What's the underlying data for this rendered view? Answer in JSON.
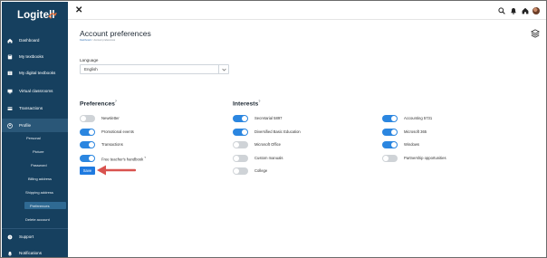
{
  "app": {
    "logo_text": "Logitell",
    "brand_color": "#16405f",
    "accent_color": "#2b86e0"
  },
  "sidebar": {
    "items": [
      {
        "label": "Dashboard",
        "icon": "home-icon"
      },
      {
        "label": "My textbooks",
        "icon": "book-icon"
      },
      {
        "label": "My digital textbooks",
        "icon": "tablet-book-icon"
      },
      {
        "label": "Virtual classrooms",
        "icon": "classroom-icon"
      },
      {
        "label": "Transactions",
        "icon": "transactions-icon"
      },
      {
        "label": "Profile",
        "icon": "profile-icon"
      }
    ],
    "profile_subitems": [
      {
        "label": "Personal"
      },
      {
        "label": "Picture"
      },
      {
        "label": "Password"
      },
      {
        "label": "Billing address"
      },
      {
        "label": "Shipping address"
      },
      {
        "label": "Preferences"
      },
      {
        "label": "Delete account"
      }
    ],
    "bottom_items": [
      {
        "label": "Support",
        "icon": "support-icon"
      },
      {
        "label": "Notifications",
        "icon": "bell-icon"
      }
    ]
  },
  "topbar": {
    "close_icon": "close-icon",
    "icons": [
      "search-icon",
      "bell-icon",
      "home-icon",
      "avatar"
    ]
  },
  "page": {
    "title": "Account preferences",
    "breadcrumb": [
      "Dashboard",
      "Account preferences"
    ]
  },
  "language": {
    "label": "Language",
    "value": "English"
  },
  "preferences": {
    "title": "Preferences",
    "superscript": "?",
    "items": [
      {
        "label": "Newsletter",
        "on": false
      },
      {
        "label": "Promotional events",
        "on": true
      },
      {
        "label": "Transactions",
        "on": true
      },
      {
        "label": "Free teacher's handbook",
        "superscript": "?",
        "on": true
      }
    ],
    "save_label": "Save"
  },
  "interests": {
    "title": "Interests",
    "superscript": "?",
    "column1": [
      {
        "label": "Secretarial 5897",
        "on": true
      },
      {
        "label": "Diversified Basic Education",
        "on": true
      },
      {
        "label": "Microsoft Office",
        "on": false
      },
      {
        "label": "Custom manuals",
        "on": false
      },
      {
        "label": "College",
        "on": false
      }
    ],
    "column2": [
      {
        "label": "Accounting 5731",
        "on": true
      },
      {
        "label": "Microsoft 365",
        "on": true
      },
      {
        "label": "Windows",
        "on": true
      },
      {
        "label": "Partnership opportunities",
        "on": false
      }
    ]
  },
  "annotation": {
    "arrow_color": "#d9534f"
  }
}
